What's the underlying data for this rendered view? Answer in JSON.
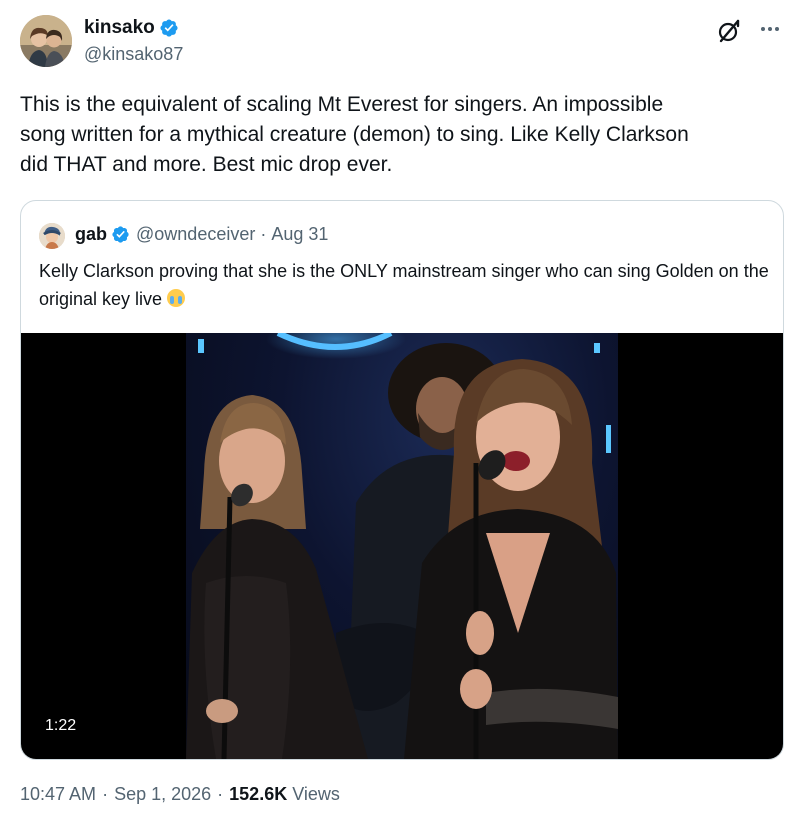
{
  "author": {
    "display_name": "kinsako",
    "handle": "@kinsako87",
    "verified": true
  },
  "tweet": {
    "text": "This is the equivalent of scaling Mt Everest for singers. An impossible\nsong written for a mythical creature (demon) to sing. Like Kelly Clarkson\ndid THAT and more. Best mic drop ever."
  },
  "header_icons": [
    "grok-icon",
    "more-icon"
  ],
  "quote": {
    "display_name": "gab",
    "handle": "@owndeceiver",
    "separator": "·",
    "date": "Aug 31",
    "verified": true,
    "text": "Kelly Clarkson proving that she is the ONLY mainstream singer who can sing Golden on the original key live",
    "emoji": "loudly-crying-face",
    "video": {
      "duration": "1:22"
    }
  },
  "meta": {
    "time": "10:47 AM",
    "separator": "·",
    "date": "Sep 1, 2026",
    "views_count": "152.6K",
    "views_label": "Views"
  },
  "colors": {
    "verified_blue": "#1d9bf0",
    "secondary_text": "#536471",
    "primary_text": "#0f1419",
    "border": "#cfd9de"
  }
}
